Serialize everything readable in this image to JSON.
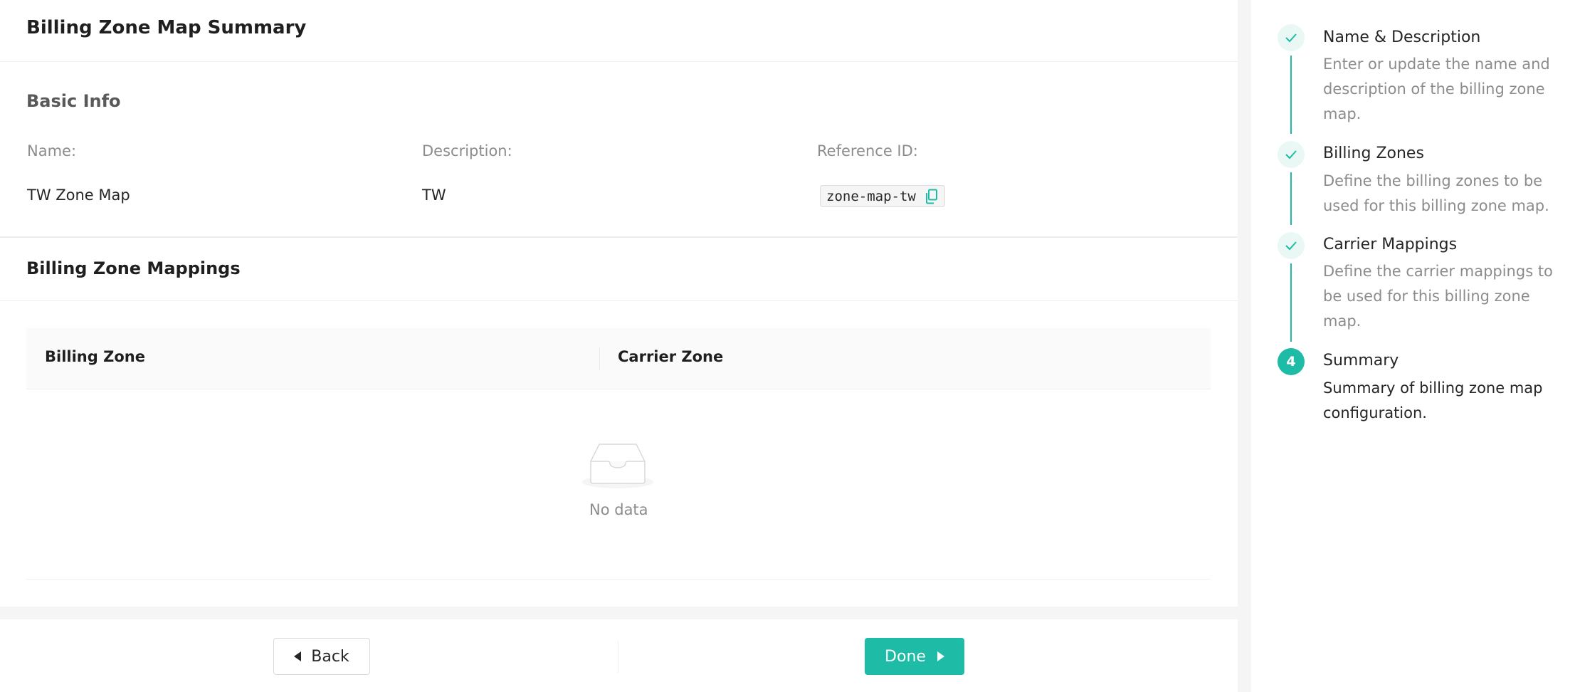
{
  "page": {
    "title": "Billing Zone Map Summary"
  },
  "basic_info": {
    "title": "Basic Info",
    "fields": [
      {
        "label": "Name:",
        "value": "TW Zone Map"
      },
      {
        "label": "Description:",
        "value": "TW"
      },
      {
        "label": "Reference ID:",
        "value": "zone-map-tw"
      }
    ]
  },
  "mappings": {
    "title": "Billing Zone Mappings",
    "columns": [
      "Billing Zone",
      "Carrier Zone"
    ],
    "rows": [],
    "empty_text": "No data"
  },
  "footer": {
    "back_label": "Back",
    "done_label": "Done"
  },
  "steps": [
    {
      "title": "Name & Description",
      "description": "Enter or update the name and description of the billing zone map.",
      "status": "done"
    },
    {
      "title": "Billing Zones",
      "description": "Define the billing zones to be used for this billing zone map.",
      "status": "done"
    },
    {
      "title": "Carrier Mappings",
      "description": "Define the carrier mappings to be used for this billing zone map.",
      "status": "done"
    },
    {
      "title": "Summary",
      "description": "Summary of billing zone map configuration.",
      "status": "current",
      "number": "4"
    }
  ],
  "colors": {
    "accent": "#1ebba6",
    "accent_light": "#e9f8f5",
    "page_background": "#f5f5f5"
  },
  "icons": {
    "copy": "copy-icon",
    "empty": "inbox-icon",
    "step_done": "check-icon",
    "back": "caret-left-icon",
    "done": "caret-right-icon"
  }
}
